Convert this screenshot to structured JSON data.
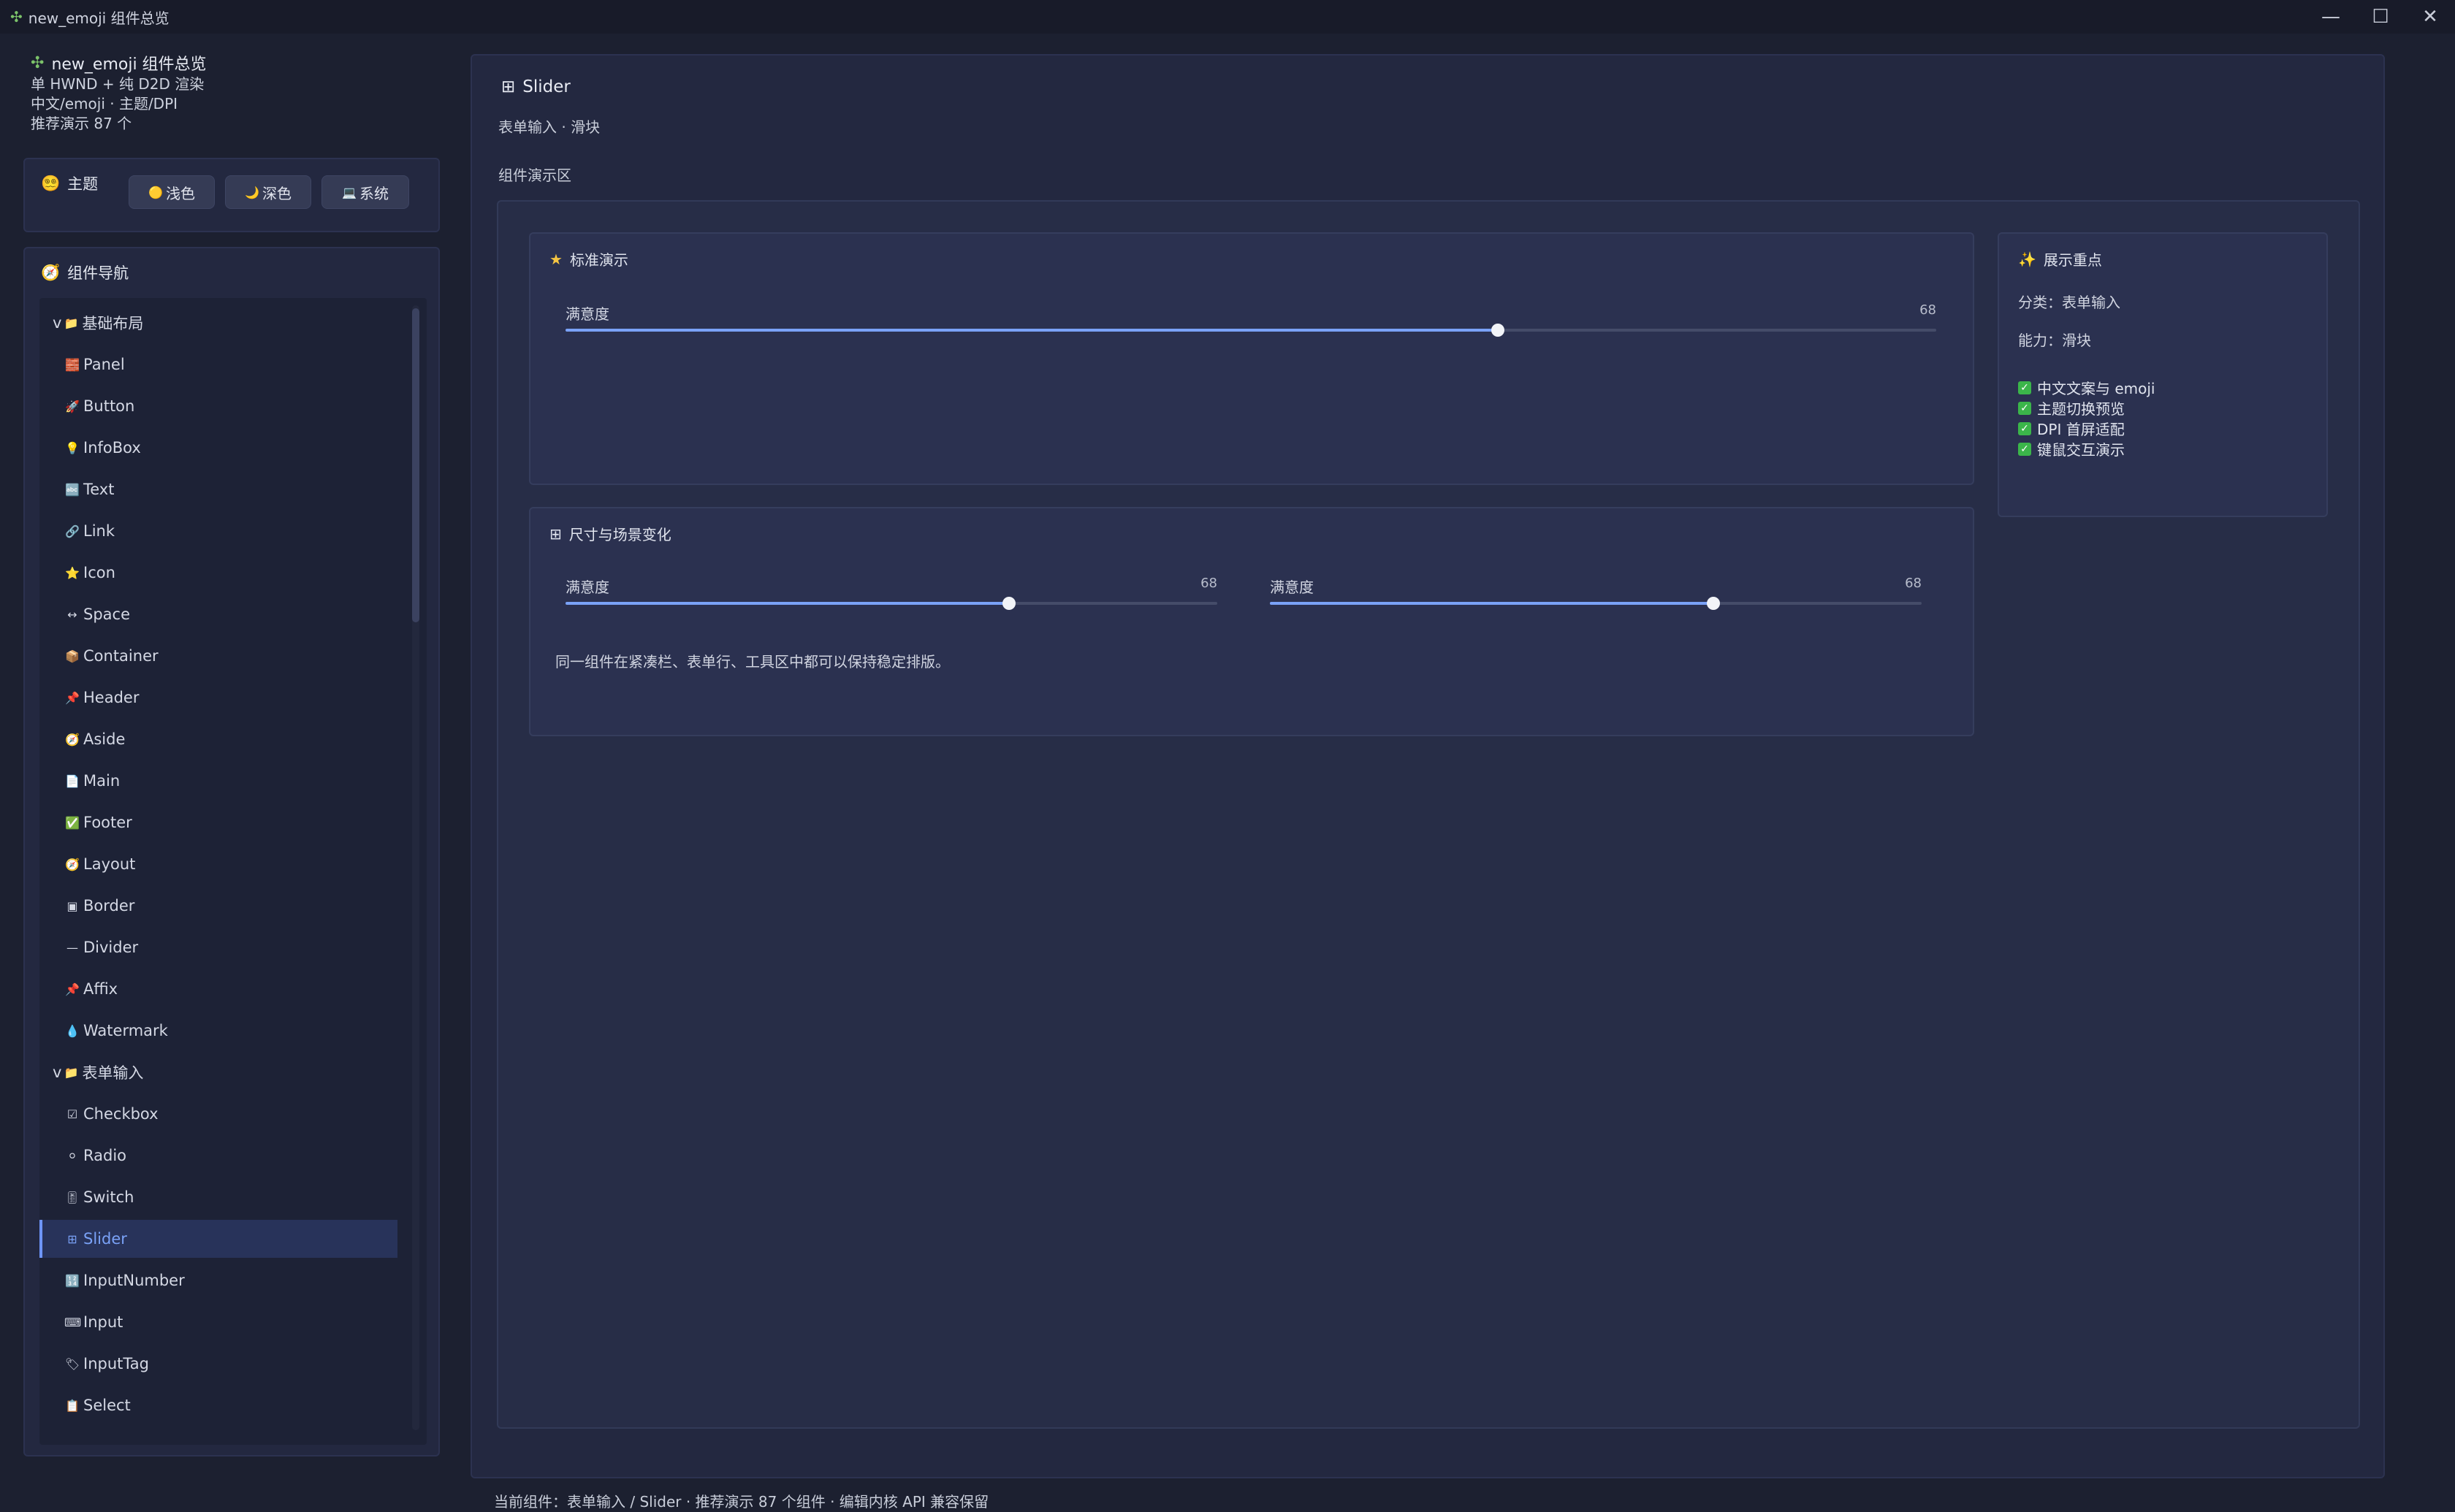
{
  "window": {
    "title": "new_emoji 组件总览",
    "controls": {
      "minimize": "—",
      "maximize": "☐",
      "close": "✕"
    }
  },
  "sidebar": {
    "app_title": "new_emoji 组件总览",
    "info_lines": [
      "单 HWND + 纯 D2D 渲染",
      "中文/emoji · 主题/DPI",
      "推荐演示 87 个"
    ],
    "theme": {
      "label": "主题",
      "buttons": [
        {
          "icon": "🟡",
          "label": "浅色"
        },
        {
          "icon": "🌙",
          "label": "深色"
        },
        {
          "icon": "💻",
          "label": "系统"
        }
      ]
    },
    "nav_title": "组件导航",
    "nav_items": [
      {
        "type": "group",
        "prefix": "v",
        "icon": "📁",
        "label": "基础布局"
      },
      {
        "type": "leaf",
        "icon": "🧱",
        "label": "Panel"
      },
      {
        "type": "leaf",
        "icon": "🚀",
        "label": "Button"
      },
      {
        "type": "leaf",
        "icon": "💡",
        "label": "InfoBox"
      },
      {
        "type": "leaf",
        "icon": "🔤",
        "label": "Text"
      },
      {
        "type": "leaf",
        "icon": "🔗",
        "label": "Link"
      },
      {
        "type": "leaf",
        "icon": "⭐",
        "label": "Icon"
      },
      {
        "type": "leaf",
        "icon": "↔",
        "label": "Space"
      },
      {
        "type": "leaf",
        "icon": "📦",
        "label": "Container"
      },
      {
        "type": "leaf",
        "icon": "📌",
        "label": "Header"
      },
      {
        "type": "leaf",
        "icon": "🧭",
        "label": "Aside"
      },
      {
        "type": "leaf",
        "icon": "📄",
        "label": "Main"
      },
      {
        "type": "leaf",
        "icon": "✅",
        "label": "Footer"
      },
      {
        "type": "leaf",
        "icon": "🧭",
        "label": "Layout"
      },
      {
        "type": "leaf",
        "icon": "▣",
        "label": "Border"
      },
      {
        "type": "leaf",
        "icon": "—",
        "label": "Divider"
      },
      {
        "type": "leaf",
        "icon": "📌",
        "label": "Affix"
      },
      {
        "type": "leaf",
        "icon": "💧",
        "label": "Watermark"
      },
      {
        "type": "group",
        "prefix": "v",
        "icon": "📁",
        "label": "表单输入"
      },
      {
        "type": "leaf",
        "icon": "☑",
        "label": "Checkbox"
      },
      {
        "type": "leaf",
        "icon": "⚪",
        "label": "Radio"
      },
      {
        "type": "leaf",
        "icon": "🎚",
        "label": "Switch"
      },
      {
        "type": "leaf",
        "icon": "⊞",
        "label": "Slider",
        "active": true
      },
      {
        "type": "leaf",
        "icon": "🔢",
        "label": "InputNumber"
      },
      {
        "type": "leaf",
        "icon": "⌨",
        "label": "Input"
      },
      {
        "type": "leaf",
        "icon": "🏷",
        "label": "InputTag"
      },
      {
        "type": "leaf",
        "icon": "📋",
        "label": "Select"
      }
    ]
  },
  "main": {
    "title": "Slider",
    "subtitle": "表单输入 · 滑块",
    "demo_label": "组件演示区",
    "standard_card": {
      "title": "标准演示",
      "slider": {
        "label": "满意度",
        "value": 68,
        "value_text": "68",
        "min": 0,
        "max": 100
      }
    },
    "size_card": {
      "title": "尺寸与场景变化",
      "sliders": [
        {
          "label": "满意度",
          "value": 68,
          "value_text": "68",
          "min": 0,
          "max": 100
        },
        {
          "label": "满意度",
          "value": 68,
          "value_text": "68",
          "min": 0,
          "max": 100
        }
      ],
      "note": "同一组件在紧凑栏、表单行、工具区中都可以保持稳定排版。"
    },
    "focus_card": {
      "title": "展示重点",
      "category": "分类：表单输入",
      "ability": "能力：滑块",
      "checks": [
        "中文文案与 emoji",
        "主题切换预览",
        "DPI 首屏适配",
        "键鼠交互演示"
      ]
    }
  },
  "status_bar": "当前组件：表单输入 / Slider · 推荐演示 87 个组件 · 编辑内核 API 兼容保留",
  "colors": {
    "accent": "#7aa2f7",
    "background": "#1c2030",
    "panel": "#232840",
    "check": "#3bb54a"
  }
}
